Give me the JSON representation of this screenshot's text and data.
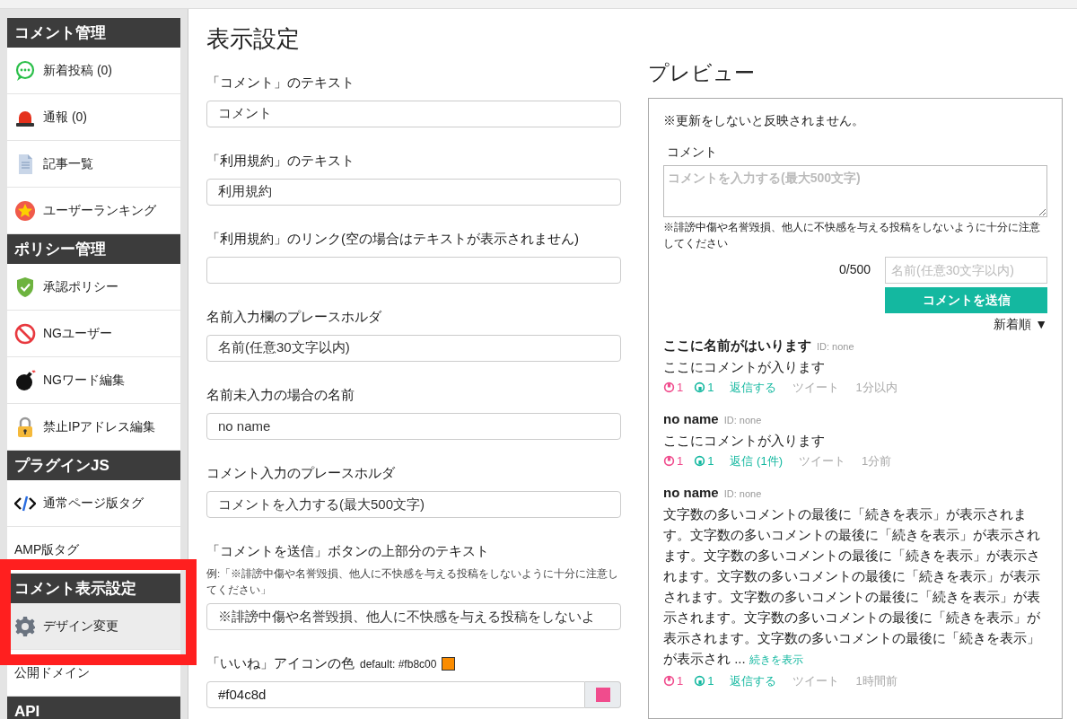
{
  "sidebar": {
    "sections": [
      {
        "title": "コメント管理",
        "items": [
          {
            "label": "新着投稿 (0)",
            "selected": false
          },
          {
            "label": "通報 (0)",
            "selected": false
          },
          {
            "label": "記事一覧",
            "selected": false
          },
          {
            "label": "ユーザーランキング",
            "selected": false
          }
        ]
      },
      {
        "title": "ポリシー管理",
        "items": [
          {
            "label": "承認ポリシー",
            "selected": false
          },
          {
            "label": "NGユーザー",
            "selected": false
          },
          {
            "label": "NGワード編集",
            "selected": false
          },
          {
            "label": "禁止IPアドレス編集",
            "selected": false
          }
        ]
      },
      {
        "title": "プラグインJS",
        "items": [
          {
            "label": "通常ページ版タグ",
            "selected": false
          },
          {
            "label": "AMP版タグ",
            "selected": false
          }
        ]
      },
      {
        "title": "コメント表示設定",
        "highlighted": true,
        "items": [
          {
            "label": "デザイン変更",
            "selected": true
          },
          {
            "label": "公開ドメイン",
            "selected": false
          }
        ]
      },
      {
        "title": "API"
      }
    ]
  },
  "page_title": "表示設定",
  "fields": [
    {
      "kind": "text",
      "label": "「コメント」のテキスト",
      "value": "コメント"
    },
    {
      "kind": "text",
      "label": "「利用規約」のテキスト",
      "value": "利用規約"
    },
    {
      "kind": "text",
      "label": "「利用規約」のリンク(空の場合はテキストが表示されません)"
    },
    {
      "kind": "text",
      "label": "名前入力欄のプレースホルダ",
      "value": "名前(任意30文字以内)"
    },
    {
      "kind": "text",
      "label": "名前未入力の場合の名前",
      "value": "no name"
    },
    {
      "kind": "text",
      "label": "コメント入力のプレースホルダ",
      "value": "コメントを入力する(最大500文字)"
    },
    {
      "kind": "text",
      "label": "「コメントを送信」ボタンの上部分のテキスト",
      "hint": "例:「※誹謗中傷や名誉毀損、他人に不快感を与える投稿をしないように十分に注意してください」",
      "value": "※誹謗中傷や名誉毀損、他人に不快感を与える投稿をしないよ"
    },
    {
      "kind": "color",
      "label": "「いいね」アイコンの色",
      "default": "default: #fb8c00",
      "default_swatch": {
        "color": "#fb8c00"
      },
      "value": "#f04c8d",
      "color": "#f04c8d"
    }
  ],
  "preview": {
    "title": "プレビュー",
    "notice": "※更新をしないと反映されません。",
    "comment_label": "コメント",
    "comment_placeholder": "コメントを入力する(最大500文字)",
    "caution": "※誹謗中傷や名誉毀損、他人に不快感を与える投稿をしないように十分に注意してください",
    "count": "0/500",
    "name_placeholder": "名前(任意30文字以内)",
    "submit": "コメントを送信",
    "sort": "新着順 ▼",
    "comments": [
      {
        "name": "ここに名前がはいります",
        "id": "ID: none",
        "body": "ここにコメントが入ります",
        "likes": "1",
        "dislikes": "1",
        "reply": "返信する",
        "tweet": "ツイート",
        "time": "1分以内"
      },
      {
        "name": "no name",
        "id": "ID: none",
        "body": "ここにコメントが入ります",
        "likes": "1",
        "dislikes": "1",
        "reply": "返信 (1件)",
        "tweet": "ツイート",
        "time": "1分前"
      },
      {
        "name": "no name",
        "id": "ID: none",
        "body": "文字数の多いコメントの最後に「続きを表示」が表示されます。文字数の多いコメントの最後に「続きを表示」が表示されます。文字数の多いコメントの最後に「続きを表示」が表示されます。文字数の多いコメントの最後に「続きを表示」が表示されます。文字数の多いコメントの最後に「続きを表示」が表示されます。文字数の多いコメントの最後に「続きを表示」が表示されます。文字数の多いコメントの最後に「続きを表示」が表示され ...",
        "more": "続きを表示",
        "likes": "1",
        "dislikes": "1",
        "reply": "返信する",
        "tweet": "ツイート",
        "time": "1時間前"
      }
    ]
  }
}
